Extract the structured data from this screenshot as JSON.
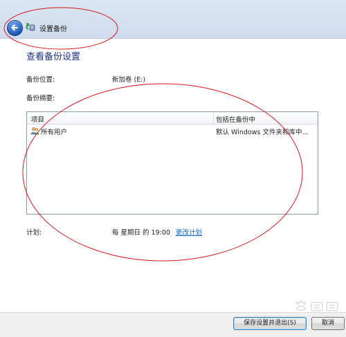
{
  "window": {
    "title": "设置备份"
  },
  "page": {
    "heading": "查看备份设置"
  },
  "settings": {
    "location_label": "备份位置:",
    "location_value": "新加卷 (E:)",
    "summary_label": "备份摘要:"
  },
  "table": {
    "columns": [
      "项目",
      "包括在备份中"
    ],
    "rows": [
      {
        "item": "所有用户",
        "included": "默认 Windows 文件夹和库中..."
      }
    ]
  },
  "schedule": {
    "label": "计划:",
    "value": "每 星期日 的 19:00",
    "change_link": "更改计划"
  },
  "buttons": {
    "save_exit": "保存设置并退出(S)",
    "cancel": "取消"
  },
  "colors": {
    "heading": "#1e3287",
    "link": "#0a64c8",
    "annotation": "#d01818"
  },
  "icons": {
    "back": "back-arrow-icon",
    "app": "backup-icon",
    "users": "users-icon"
  }
}
